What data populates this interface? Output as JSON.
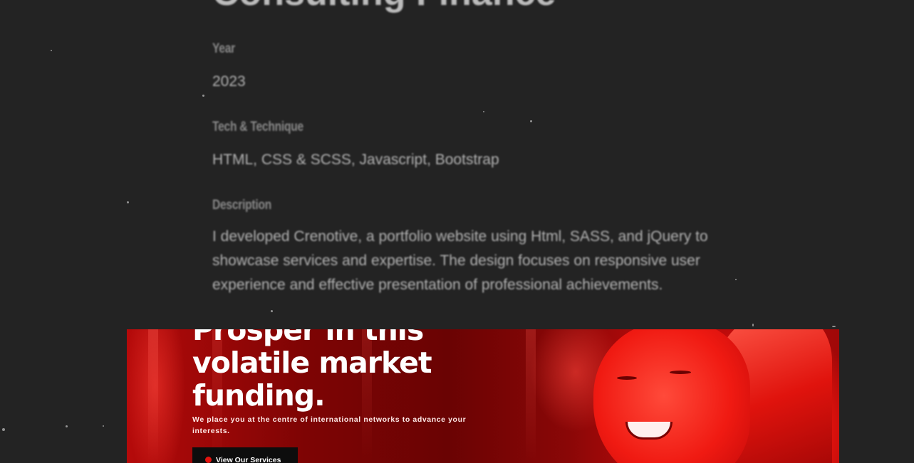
{
  "project": {
    "title": "Consulting Finance",
    "year_label": "Year",
    "year_value": "2023",
    "tech_label": "Tech & Technique",
    "tech_value": "HTML, CSS & SCSS, Javascript, Bootstrap",
    "description_label": "Description",
    "description_text": "I developed Crenotive, a portfolio website using Html, SASS, and jQuery to showcase services and expertise. The design focuses on responsive user experience and effective presentation of professional achievements."
  },
  "hero": {
    "title_line_1": "Prosper in this",
    "title_line_2": "volatile market",
    "title_line_3": "funding.",
    "subtitle": "We place you at the centre of international networks to advance your interests.",
    "button_label": "View Our Services",
    "button_icon": "gear-icon"
  },
  "colors": {
    "page_background": "#232323",
    "hero_accent": "#e3130e",
    "button_background": "#0d0d0d",
    "muted_text": "#8a8a8a",
    "body_text": "#b3b3b3"
  }
}
